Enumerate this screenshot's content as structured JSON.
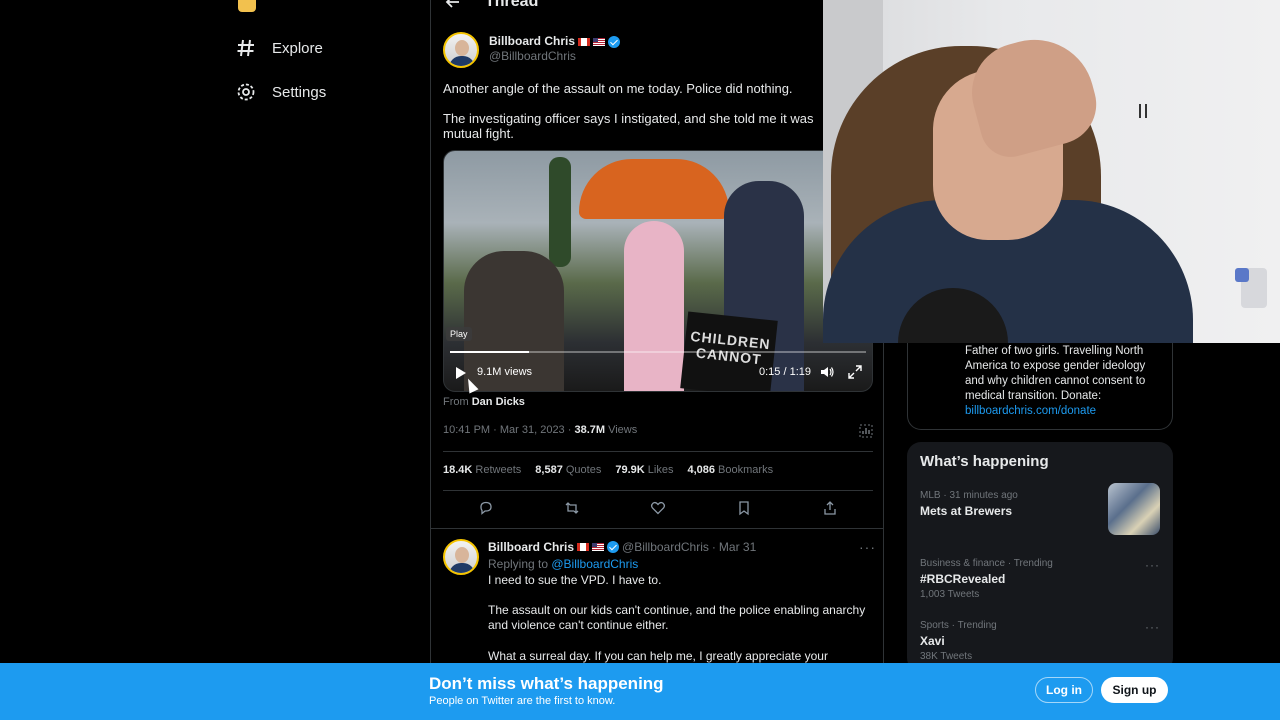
{
  "nav": {
    "explore": "Explore",
    "settings": "Settings"
  },
  "thread": {
    "title": "Thread"
  },
  "tweet": {
    "author_name": "Billboard Chris",
    "author_handle": "@BillboardChris",
    "text_1": "Another angle of the assault on me today. Police did nothing.",
    "text_2": "The investigating officer says I instigated, and she told me it was mutual fight.",
    "video": {
      "play_label": "Play",
      "views": "9.1M views",
      "time": "0:15 / 1:19",
      "progress": 0.19,
      "sign_text": "CHILDREN CANNOT"
    },
    "from_label": "From",
    "from_name": "Dan Dicks",
    "timestamp": "10:41 PM · Mar 31, 2023 · ",
    "views_count": "38.7M",
    "views_label": " Views",
    "stats": {
      "retweets_count": "18.4K",
      "retweets_label": "Retweets",
      "quotes_count": "8,587",
      "quotes_label": "Quotes",
      "likes_count": "79.9K",
      "likes_label": "Likes",
      "bookmarks_count": "4,086",
      "bookmarks_label": "Bookmarks"
    }
  },
  "reply": {
    "author_name": "Billboard Chris",
    "author_handle": "@BillboardChris",
    "date": "Mar 31",
    "separator": "·",
    "replying_label": "Replying to ",
    "replying_to": "@BillboardChris",
    "text_1": "I need to sue the VPD. I have to.",
    "text_2": "The assault on our kids can't continue, and the police enabling anarchy and violence can't continue either.",
    "text_3": "What a surreal day. If you can help me, I greatly appreciate your support."
  },
  "bio": {
    "text": "Father of two girls. Travelling North America to expose gender ideology and why children cannot consent to medical transition. Donate:",
    "link": "billboardchris.com/donate"
  },
  "happening": {
    "title": "What’s happening",
    "trends": [
      {
        "meta": "MLB · 31 minutes ago",
        "name": "Mets at Brewers",
        "count": ""
      },
      {
        "meta": "Business & finance · Trending",
        "name": "#RBCRevealed",
        "count": "1,003 Tweets"
      },
      {
        "meta": "Sports · Trending",
        "name": "Xavi",
        "count": "38K Tweets"
      }
    ]
  },
  "banner": {
    "title": "Don’t miss what’s happening",
    "subtitle": "People on Twitter are the first to know.",
    "login": "Log in",
    "signup": "Sign up"
  },
  "colors": {
    "accent": "#1d9bf0",
    "background": "#000000",
    "text": "#e7e9ea",
    "muted": "#71767b"
  }
}
